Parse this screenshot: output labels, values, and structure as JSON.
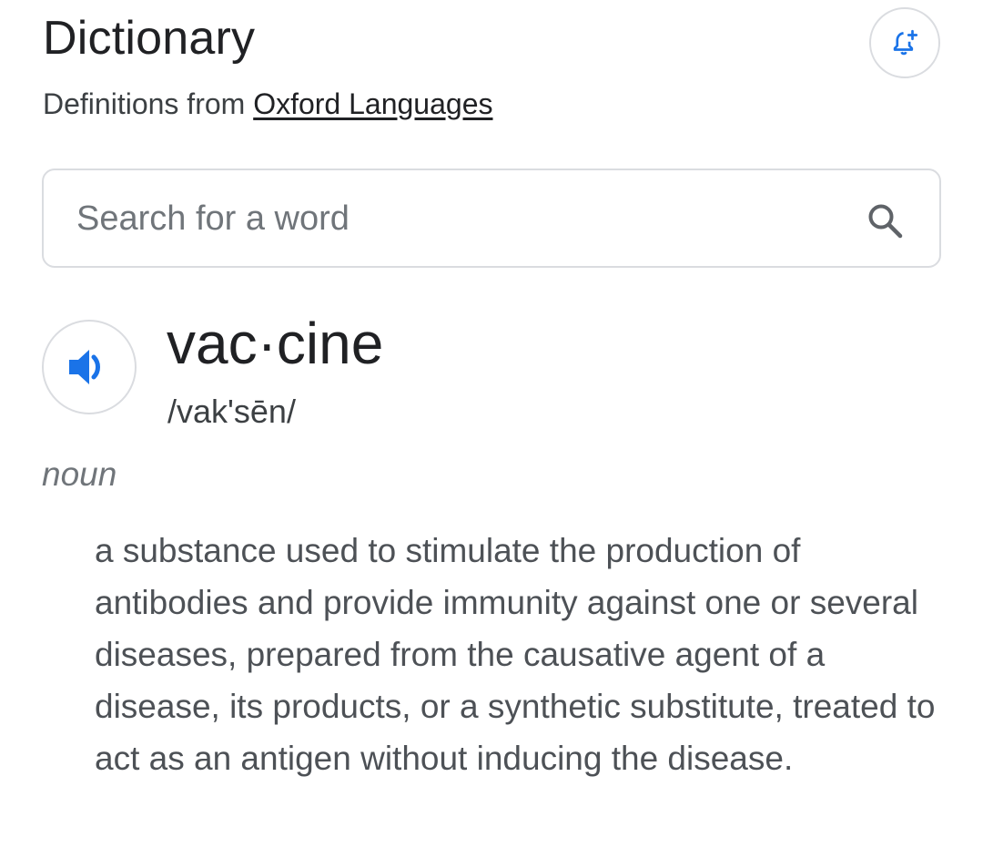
{
  "header": {
    "title": "Dictionary",
    "subtitle_prefix": "Definitions from ",
    "source_link": "Oxford Languages"
  },
  "alert_button": {
    "icon": "bell-plus-icon"
  },
  "search": {
    "placeholder": "Search for a word",
    "value": "",
    "icon": "search-icon"
  },
  "entry": {
    "headword": "vac·cine",
    "phonetic": "/vak'sēn/",
    "pronounce_icon": "speaker-icon",
    "part_of_speech": "noun",
    "definition": "a substance used to stimulate the production of antibodies and provide immunity against one or several diseases, prepared from the causative agent of a disease, its products, or a synthetic substitute, treated to act as an antigen without inducing the disease."
  },
  "colors": {
    "accent": "#1a73e8",
    "border": "#dadce0",
    "text_primary": "#202124",
    "text_secondary": "#4d5156"
  }
}
